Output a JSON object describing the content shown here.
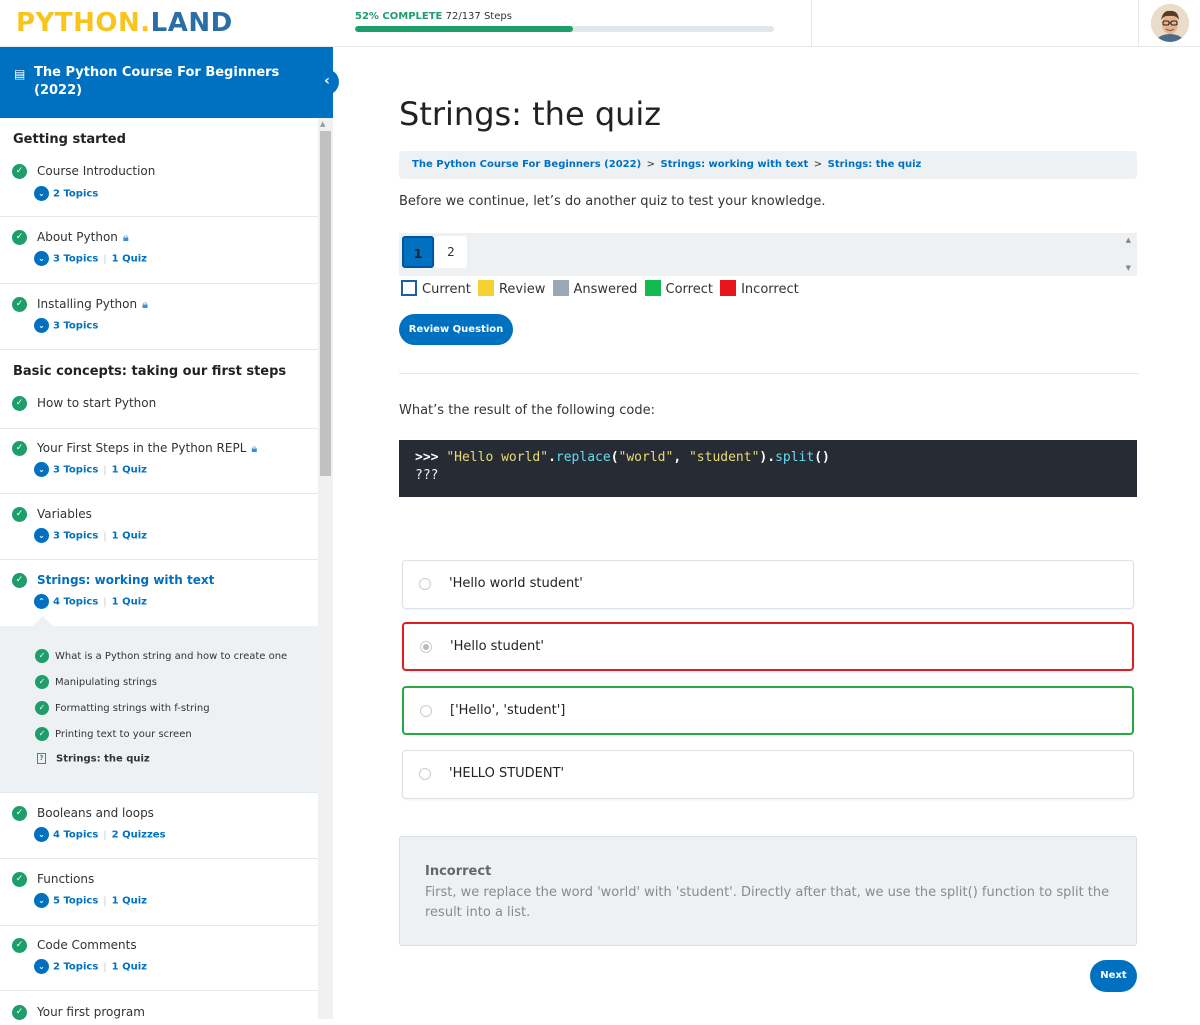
{
  "header": {
    "logo_part1": "PYTHON.",
    "logo_part2": "LAND",
    "progress_pct_label": "52% COMPLETE",
    "progress_steps_label": "72/137 Steps",
    "progress_fraction": 0.52
  },
  "sidebar": {
    "course_title": "The Python Course For Beginners (2022)",
    "collapse_glyph": "‹",
    "sections": [
      {
        "title": "Getting started"
      },
      {
        "title": "Basic concepts: taking our first steps"
      }
    ],
    "lessons": [
      {
        "title": "Course Introduction",
        "topics": "2 Topics",
        "quiz": "",
        "locked": false
      },
      {
        "title": "About Python",
        "topics": "3 Topics",
        "quiz": "1 Quiz",
        "locked": true
      },
      {
        "title": "Installing Python",
        "topics": "3 Topics",
        "quiz": "",
        "locked": true
      },
      {
        "title": "How to start Python",
        "topics": "",
        "quiz": "",
        "locked": false
      },
      {
        "title": "Your First Steps in the Python REPL",
        "topics": "3 Topics",
        "quiz": "1 Quiz",
        "locked": true
      },
      {
        "title": "Variables",
        "topics": "3 Topics",
        "quiz": "1 Quiz",
        "locked": false
      },
      {
        "title": "Strings: working with text",
        "topics": "4 Topics",
        "quiz": "1 Quiz",
        "locked": false
      },
      {
        "title": "Booleans and loops",
        "topics": "4 Topics",
        "quiz": "2 Quizzes",
        "locked": false
      },
      {
        "title": "Functions",
        "topics": "5 Topics",
        "quiz": "1 Quiz",
        "locked": false
      },
      {
        "title": "Code Comments",
        "topics": "2 Topics",
        "quiz": "1 Quiz",
        "locked": false
      },
      {
        "title": "Your first program",
        "topics": "",
        "quiz": "",
        "locked": false
      }
    ],
    "subtopics": [
      "What is a Python string and how to create one",
      "Manipulating strings",
      "Formatting strings with f-string",
      "Printing text to your screen",
      "Strings: the quiz"
    ]
  },
  "main": {
    "title": "Strings: the quiz",
    "breadcrumb": [
      "The Python Course For Beginners (2022)",
      "Strings: working with text",
      "Strings: the quiz"
    ],
    "breadcrumb_sep": ">",
    "intro": "Before we continue, let’s do another quiz to test your knowledge.",
    "question_nav": [
      "1",
      "2"
    ],
    "legend": [
      "Current",
      "Review",
      "Answered",
      "Correct",
      "Incorrect"
    ],
    "review_button": "Review Question",
    "question": "What’s the result of the following code:",
    "code": {
      "prompt": ">>>",
      "str1": "\"Hello world\"",
      "dot1": ".",
      "fn1": "replace",
      "paren_open": "(",
      "str2": "\"world\"",
      "comma": ", ",
      "str3": "\"student\"",
      "paren_close": ").",
      "fn2": "split",
      "call": "()",
      "line2": "???"
    },
    "answers": [
      {
        "text": "'Hello world student'",
        "state": "none"
      },
      {
        "text": "'Hello student'",
        "state": "incorrect"
      },
      {
        "text": "['Hello', 'student']",
        "state": "correct"
      },
      {
        "text": "'HELLO STUDENT'",
        "state": "none"
      }
    ],
    "feedback_title": "Incorrect",
    "feedback_text": "First, we replace the word 'world' with 'student'. Directly after that, we use the split() function to split the result into a list.",
    "next_button": "Next"
  },
  "colors": {
    "brand_blue": "#0071c1",
    "progress_green": "#1e9e6b",
    "legend_current": "#1a5ea8",
    "legend_review": "#f5d033",
    "legend_answered": "#9aa7b5",
    "legend_correct": "#12b94e",
    "legend_incorrect": "#e8141b"
  }
}
